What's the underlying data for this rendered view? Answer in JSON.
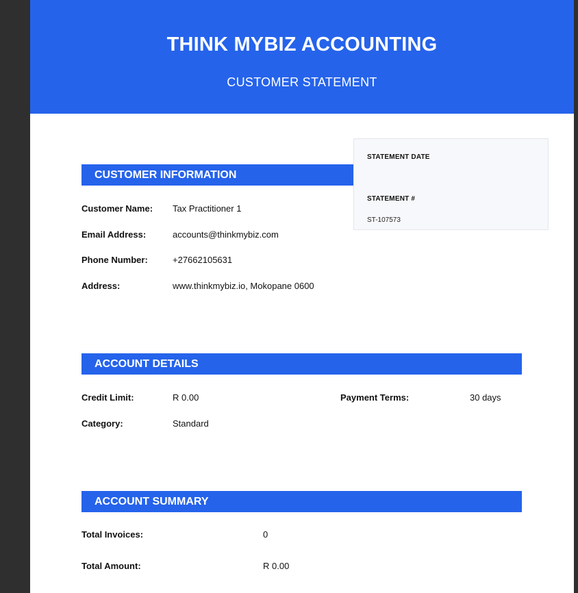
{
  "header": {
    "company": "THINK MYBIZ ACCOUNTING",
    "title": "CUSTOMER STATEMENT"
  },
  "meta": {
    "statement_date_label": "STATEMENT DATE",
    "statement_date_value": "",
    "statement_no_label": "STATEMENT #",
    "statement_no_value": "ST-107573"
  },
  "customer_info": {
    "heading": "CUSTOMER INFORMATION",
    "rows": [
      {
        "label": "Customer Name:",
        "value": "Tax Practitioner 1"
      },
      {
        "label": "Email Address:",
        "value": "accounts@thinkmybiz.com"
      },
      {
        "label": "Phone Number:",
        "value": "+27662105631"
      },
      {
        "label": "Address:",
        "value": "www.thinkmybiz.io, Mokopane 0600"
      }
    ]
  },
  "account_details": {
    "heading": "ACCOUNT DETAILS",
    "credit_limit_label": "Credit Limit:",
    "credit_limit_value": "R 0.00",
    "payment_terms_label": "Payment Terms:",
    "payment_terms_value": "30 days",
    "category_label": "Category:",
    "category_value": "Standard"
  },
  "account_summary": {
    "heading": "ACCOUNT SUMMARY",
    "rows": [
      {
        "label": "Total Invoices:",
        "value": "0"
      },
      {
        "label": "Total Amount:",
        "value": "R 0.00"
      }
    ]
  },
  "colors": {
    "brand_blue": "#2563eb",
    "meta_box_bg": "#f7f8fb",
    "viewer_bg": "#2f2f2f"
  }
}
